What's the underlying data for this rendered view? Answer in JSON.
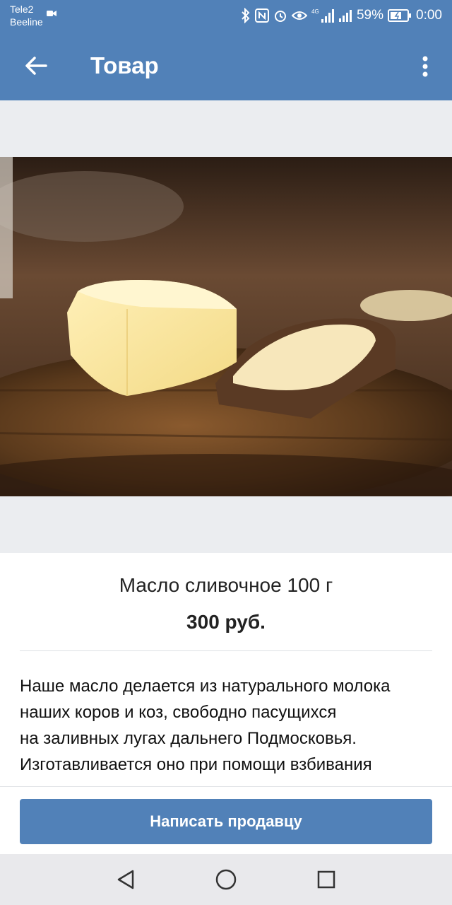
{
  "status_bar": {
    "carrier_1": "Tele2",
    "carrier_2": "Beeline",
    "network_label": "4G",
    "battery_percent": "59%",
    "time": "0:00"
  },
  "header": {
    "title": "Товар",
    "back_icon": "arrow-left-icon",
    "menu_icon": "more-vertical-icon"
  },
  "product": {
    "photo_description_icon": "product-photo",
    "name": "Масло сливочное 100 г",
    "price": "300 руб.",
    "description_lines": [
      "Наше масло делается из натурального молока",
      "наших коров и коз, свободно пасущихся",
      "на заливных лугах дальнего Подмосковья.",
      "Изготавливается оно при помощи взбивания"
    ]
  },
  "actions": {
    "write_seller_label": "Написать продавцу"
  },
  "nav_bar": {
    "back_icon": "triangle-back-icon",
    "home_icon": "circle-home-icon",
    "recents_icon": "square-recents-icon"
  },
  "colors": {
    "brand": "#5181b8",
    "background": "#ebedf0"
  }
}
